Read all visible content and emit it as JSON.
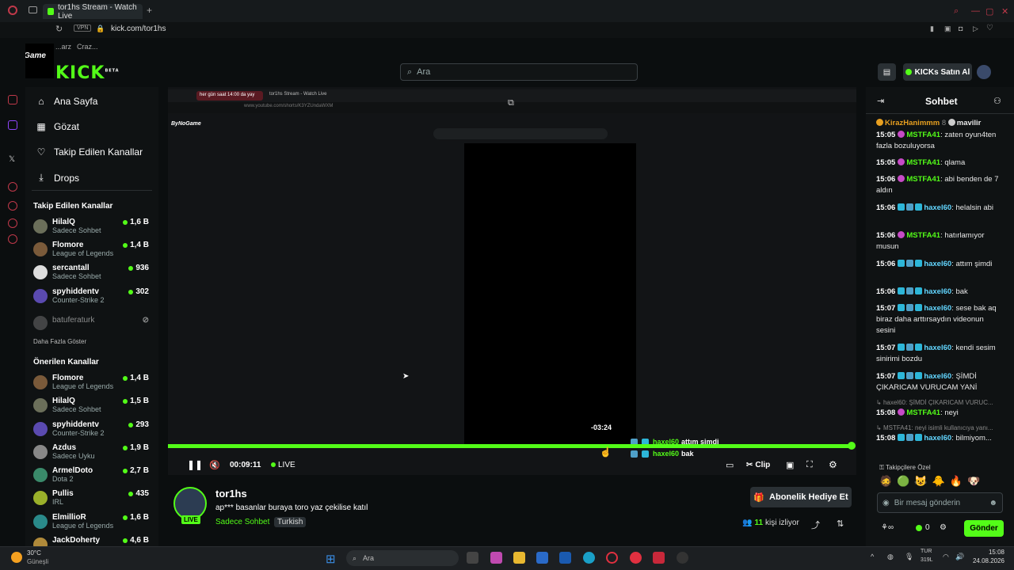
{
  "browser": {
    "tab_title": "tor1hs Stream - Watch Live",
    "url": "kick.com/tor1hs",
    "vpn_label": "VPN",
    "bookmarks": [
      "ByNoGame",
      "...arz",
      "Craz..."
    ]
  },
  "brand": {
    "logo": "KICK",
    "beta": "BETA",
    "accent": "#53fc18"
  },
  "search": {
    "placeholder": "Ara"
  },
  "header": {
    "kicks_button": "KICKs Satın Al"
  },
  "nav": [
    {
      "label": "Ana Sayfa",
      "icon": "home-icon"
    },
    {
      "label": "Gözat",
      "icon": "browse-icon"
    },
    {
      "label": "Takip Edilen Kanallar",
      "icon": "heart-icon"
    },
    {
      "label": "Drops",
      "icon": "drops-icon"
    }
  ],
  "followed": {
    "title": "Takip Edilen Kanallar",
    "channels": [
      {
        "name": "HilalQ",
        "game": "Sadece Sohbet",
        "viewers": "1,6 B"
      },
      {
        "name": "Flomore",
        "game": "League of Legends",
        "viewers": "1,4 B"
      },
      {
        "name": "sercantall",
        "game": "Sadece Sohbet",
        "viewers": "936"
      },
      {
        "name": "spyhiddentv",
        "game": "Counter-Strike 2",
        "viewers": "302"
      },
      {
        "name": "batuferaturk",
        "game": "",
        "viewers": ""
      }
    ],
    "show_more": "Daha Fazla Göster"
  },
  "recommended": {
    "title": "Önerilen Kanallar",
    "channels": [
      {
        "name": "Flomore",
        "game": "League of Legends",
        "viewers": "1,4 B"
      },
      {
        "name": "HilalQ",
        "game": "Sadece Sohbet",
        "viewers": "1,5 B"
      },
      {
        "name": "spyhiddentv",
        "game": "Counter-Strike 2",
        "viewers": "293"
      },
      {
        "name": "Azdus",
        "game": "Sadece Uyku",
        "viewers": "1,9 B"
      },
      {
        "name": "ArmelDoto",
        "game": "Dota 2",
        "viewers": "2,7 B"
      },
      {
        "name": "Pullis",
        "game": "IRL",
        "viewers": "435"
      },
      {
        "name": "ElmillioR",
        "game": "League of Legends",
        "viewers": "1,6 B"
      },
      {
        "name": "JackDoherty",
        "game": "",
        "viewers": "4,6 B"
      }
    ]
  },
  "player": {
    "inner_tab": "her gün saat 14:00 da yay",
    "inner_tab2": "tor1hs Stream - Watch Live",
    "inner_url": "www.youtube.com/shorts/K3YZUndaWXM",
    "inner_bookmark": "ByNoGame",
    "elapsed": "00:09:11",
    "live_label": "LIVE",
    "hover_time": "-03:24",
    "progress": 1.0,
    "clip_label": "Clip",
    "overlay_chat": [
      {
        "user": "haxel60",
        "text": "attım şimdi"
      },
      {
        "user": "haxel60",
        "text": "bak"
      }
    ],
    "inner_search": "Ara"
  },
  "stream": {
    "channel": "tor1hs",
    "title": "ap*** basanlar buraya toro yaz çekilise katıl",
    "category": "Sadece Sohbet",
    "language": "Turkish",
    "live_badge": "LIVE",
    "viewers_count": "11",
    "viewers_label": "kişi izliyor",
    "subscribe_button": "Abonelik Hediye Et"
  },
  "chat": {
    "title": "Sohbet",
    "pinned": {
      "user1": "KirazHanimmm",
      "num": "8",
      "user2": "mavilir"
    },
    "messages": [
      {
        "time": "15:05",
        "user": "MSTFA41",
        "text": ": zaten oyun4ten fazla bozuluyorsa",
        "kind": "p"
      },
      {
        "time": "15:05",
        "user": "MSTFA41",
        "text": ": qlama",
        "kind": "p"
      },
      {
        "time": "15:06",
        "user": "MSTFA41",
        "text": ": abi benden de 7 aldın",
        "kind": "p"
      },
      {
        "time": "15:06",
        "user": "haxel60",
        "text": ": helalsin abi",
        "kind": "c"
      },
      {
        "time": "15:06",
        "user": "MSTFA41",
        "text": ": hatırlamıyor musun",
        "kind": "p"
      },
      {
        "time": "15:06",
        "user": "haxel60",
        "text": ": attım şimdi",
        "kind": "c"
      },
      {
        "time": "15:06",
        "user": "haxel60",
        "text": ": bak",
        "kind": "c"
      },
      {
        "time": "15:07",
        "user": "haxel60",
        "text": ": sese bak aq biraz daha arttırsaydın videonun sesini",
        "kind": "c"
      },
      {
        "time": "15:07",
        "user": "haxel60",
        "text": ": kendi sesim sinirimi bozdu",
        "kind": "c"
      },
      {
        "time": "15:07",
        "user": "haxel60",
        "text": ": ŞİMDİ ÇIKARICAM VURUCAM YANİ",
        "kind": "c"
      }
    ],
    "reply1": "haxel60: ŞİMDİ ÇIKARICAM VURUC...",
    "msg_after1": {
      "time": "15:08",
      "user": "MSTFA41",
      "text": ": neyi"
    },
    "reply2": "MSTFA41: neyi isimli kullanıcıya yanı...",
    "msg_after2": {
      "time": "15:08",
      "user": "haxel60",
      "text": ": bilmiyom..."
    },
    "special_label": "Takipçilere Özel",
    "input_placeholder": "Bir mesaj gönderin",
    "points_a": "0",
    "send_button": "Gönder"
  },
  "taskbar": {
    "weather_temp": "30°C",
    "weather_desc": "Güneşli",
    "search": "Ara",
    "lang": "TUR",
    "lang2": "319L",
    "time": "15:08",
    "date": "24.08.2026"
  }
}
